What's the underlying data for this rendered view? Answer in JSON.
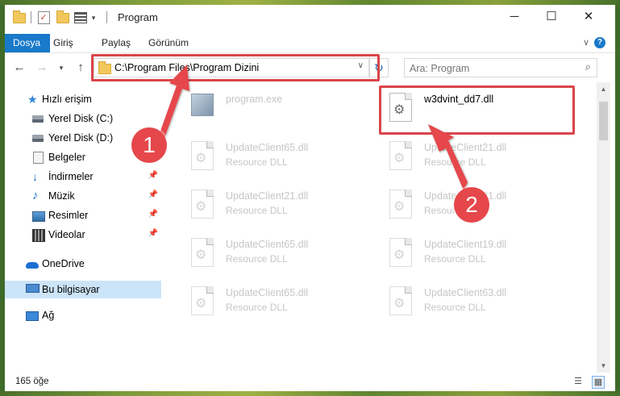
{
  "window": {
    "title": "Program",
    "controls": {
      "minimize": "─",
      "maximize": "☐",
      "close": "✕"
    }
  },
  "ribbon": {
    "tabs": [
      {
        "label": "Dosya",
        "active": true
      },
      {
        "label": "Giriş"
      },
      {
        "label": "Paylaş"
      },
      {
        "label": "Görünüm"
      }
    ],
    "help": "?"
  },
  "address": {
    "path": "C:\\Program Files\\Program Dizini",
    "search_placeholder": "Ara: Program"
  },
  "nav_pane": {
    "items": [
      {
        "label": "Hızlı erişim",
        "icon": "star-icon"
      },
      {
        "label": "Yerel Disk (C:)",
        "icon": "drive-icon"
      },
      {
        "label": "Yerel Disk (D:)",
        "icon": "drive-icon"
      },
      {
        "label": "Belgeler",
        "icon": "documents-icon",
        "pinned": true
      },
      {
        "label": "İndirmeler",
        "icon": "downloads-icon",
        "pinned": true
      },
      {
        "label": "Müzik",
        "icon": "music-icon",
        "pinned": true
      },
      {
        "label": "Resimler",
        "icon": "pictures-icon",
        "pinned": true
      },
      {
        "label": "Videolar",
        "icon": "videos-icon",
        "pinned": true
      },
      {
        "label": "OneDrive",
        "icon": "onedrive-icon"
      },
      {
        "label": "Bu bilgisayar",
        "icon": "this-pc-icon",
        "selected": true
      },
      {
        "label": "Ağ",
        "icon": "network-icon"
      }
    ]
  },
  "files": [
    {
      "name": "program.exe",
      "type": "",
      "icon": "exe-icon",
      "faded": true
    },
    {
      "name": "w3dvint_dd7.dll",
      "type": "",
      "icon": "dll-gear-icon",
      "highlighted": true
    },
    {
      "name": "UpdateClient65.dll",
      "type": "Resource DLL",
      "faded": true
    },
    {
      "name": "UpdateClient21.dll",
      "type": "Resource DLL",
      "faded": true
    },
    {
      "name": "UpdateClient21.dll",
      "type": "Resource DLL",
      "faded": true
    },
    {
      "name": "UpdateClient21.dll",
      "type": "Resource DLL",
      "faded": true
    },
    {
      "name": "UpdateClient65.dll",
      "type": "Resource DLL",
      "faded": true
    },
    {
      "name": "UpdateClient19.dll",
      "type": "Resource DLL",
      "faded": true
    },
    {
      "name": "UpdateClient65.dll",
      "type": "Resource DLL",
      "faded": true
    },
    {
      "name": "UpdateClient63.dll",
      "type": "Resource DLL",
      "faded": true
    }
  ],
  "status": {
    "item_count": "165 öğe"
  },
  "callouts": {
    "one": "1",
    "two": "2"
  },
  "colors": {
    "accent": "#1979ca",
    "highlight_red": "#d9454a",
    "callout_red": "#e5474b",
    "selection": "#cce4f7"
  }
}
